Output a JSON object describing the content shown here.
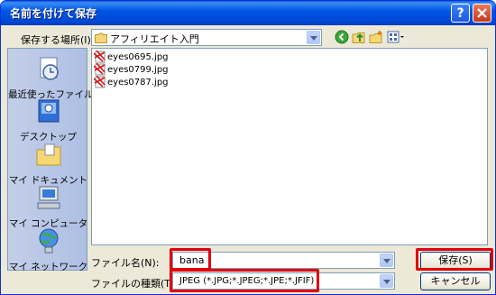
{
  "window": {
    "title": "名前を付けて保存"
  },
  "titlebar": {
    "help_label": "?",
    "close_label": "✕"
  },
  "location": {
    "label": "保存する場所(I):",
    "value": "アフィリエイト入門",
    "folder_icon": "folder-icon"
  },
  "toolbar": {
    "icons": [
      "back-icon",
      "up-folder-icon",
      "new-folder-icon",
      "view-menu-icon"
    ]
  },
  "places": [
    {
      "label": "最近使ったファイル",
      "icon": "recent-icon"
    },
    {
      "label": "デスクトップ",
      "icon": "desktop-icon"
    },
    {
      "label": "マイ ドキュメント",
      "icon": "my-documents-icon"
    },
    {
      "label": "マイ コンピュータ",
      "icon": "my-computer-icon"
    },
    {
      "label": "マイ ネットワーク",
      "icon": "my-network-icon"
    }
  ],
  "files": [
    {
      "name": "eyes0695.jpg",
      "icon": "jpg-file-icon"
    },
    {
      "name": "eyes0799.jpg",
      "icon": "jpg-file-icon"
    },
    {
      "name": "eyes0787.jpg",
      "icon": "jpg-file-icon"
    }
  ],
  "filename": {
    "label": "ファイル名(N):",
    "value": "bana"
  },
  "filetype": {
    "label": "ファイルの種類(T):",
    "value": "JPEG (*.JPG;*.JPEG;*.JPE;*.JFIF)"
  },
  "buttons": {
    "save": "保存(S)",
    "cancel": "キャンセル"
  },
  "highlight_color": "#e0000e"
}
